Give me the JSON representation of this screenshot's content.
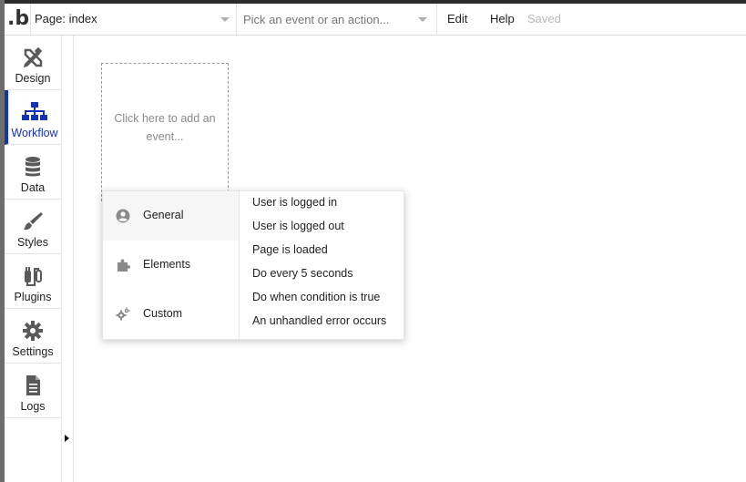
{
  "topbar": {
    "logo": ".b",
    "page_select": "Page: index",
    "event_select_placeholder": "Pick an event or an action...",
    "menu_edit": "Edit",
    "menu_help": "Help",
    "status": "Saved"
  },
  "sidebar": {
    "items": [
      {
        "label": "Design",
        "icon": "design-icon"
      },
      {
        "label": "Workflow",
        "icon": "workflow-icon",
        "active": true
      },
      {
        "label": "Data",
        "icon": "database-icon"
      },
      {
        "label": "Styles",
        "icon": "brush-icon"
      },
      {
        "label": "Plugins",
        "icon": "plug-icon"
      },
      {
        "label": "Settings",
        "icon": "gear-icon"
      },
      {
        "label": "Logs",
        "icon": "document-icon"
      }
    ]
  },
  "canvas": {
    "add_event_hint": "Click here to add an event..."
  },
  "event_menu": {
    "categories": [
      {
        "label": "General",
        "icon": "user-circle-icon",
        "active": true
      },
      {
        "label": "Elements",
        "icon": "puzzle-icon"
      },
      {
        "label": "Custom",
        "icon": "gears-icon"
      }
    ],
    "options": [
      "User is logged in",
      "User is logged out",
      "Page is loaded",
      "Do every 5 seconds",
      "Do when condition is true",
      "An unhandled error occurs"
    ]
  },
  "colors": {
    "accent": "#1432b3",
    "icon_gray": "#5a5a5a",
    "status_muted": "#b9b9b9"
  }
}
